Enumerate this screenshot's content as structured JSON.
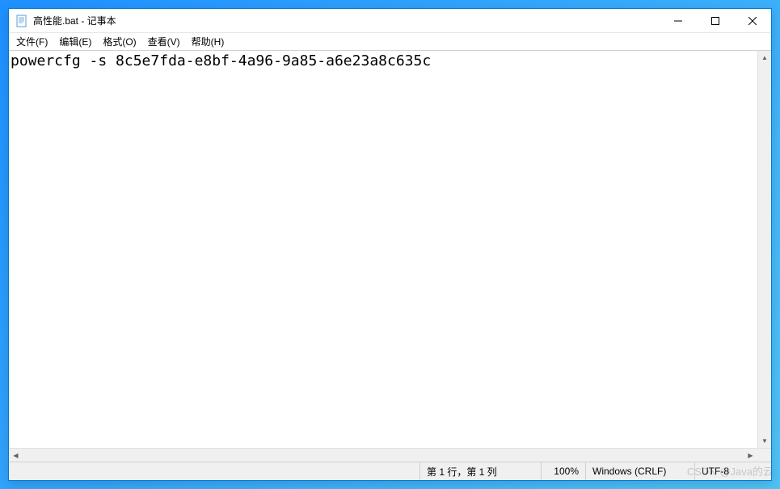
{
  "titlebar": {
    "title": "高性能.bat - 记事本"
  },
  "menubar": {
    "file": "文件(F)",
    "edit": "编辑(E)",
    "format": "格式(O)",
    "view": "查看(V)",
    "help": "帮助(H)"
  },
  "editor": {
    "content": "powercfg -s 8c5e7fda-e8bf-4a96-9a85-a6e23a8c635c"
  },
  "statusbar": {
    "position": "第 1 行，第 1 列",
    "zoom": "100%",
    "line_ending": "Windows (CRLF)",
    "encoding": "UTF-8"
  },
  "watermark": "CSDN @Java的云"
}
